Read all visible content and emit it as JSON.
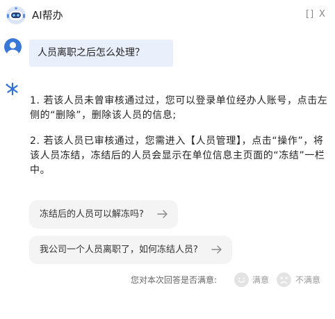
{
  "header": {
    "title": "AI帮办",
    "logo_icon": "robot-assistant-icon",
    "maximize_label": "[]",
    "close_label": "X"
  },
  "chat": {
    "user_message": "人员离职之后怎么处理？",
    "ai_answer": {
      "paragraphs": [
        "1. 若该人员未曾审核通过过，您可以登录单位经办人账号，点击左侧的“删除”，删除该人员的信息;",
        "2. 若该人员已审核通过，您需进入【人员管理】，点击“操作”，将该人员冻结，冻结后的人员会显示在单位信息主页面的“冻结”一栏中。"
      ]
    }
  },
  "suggestions": [
    "冻结后的人员可以解冻吗?",
    "我公司一个人员离职了，如何冻结人员?"
  ],
  "feedback": {
    "question": "您对本次回答是否满意:",
    "satisfied_label": "满意",
    "unsatisfied_label": "不满意"
  },
  "colors": {
    "user_bubble": "#e9effb",
    "accent_blue": "#2f6fd6",
    "suggestion_bg": "#f4f4f5"
  }
}
